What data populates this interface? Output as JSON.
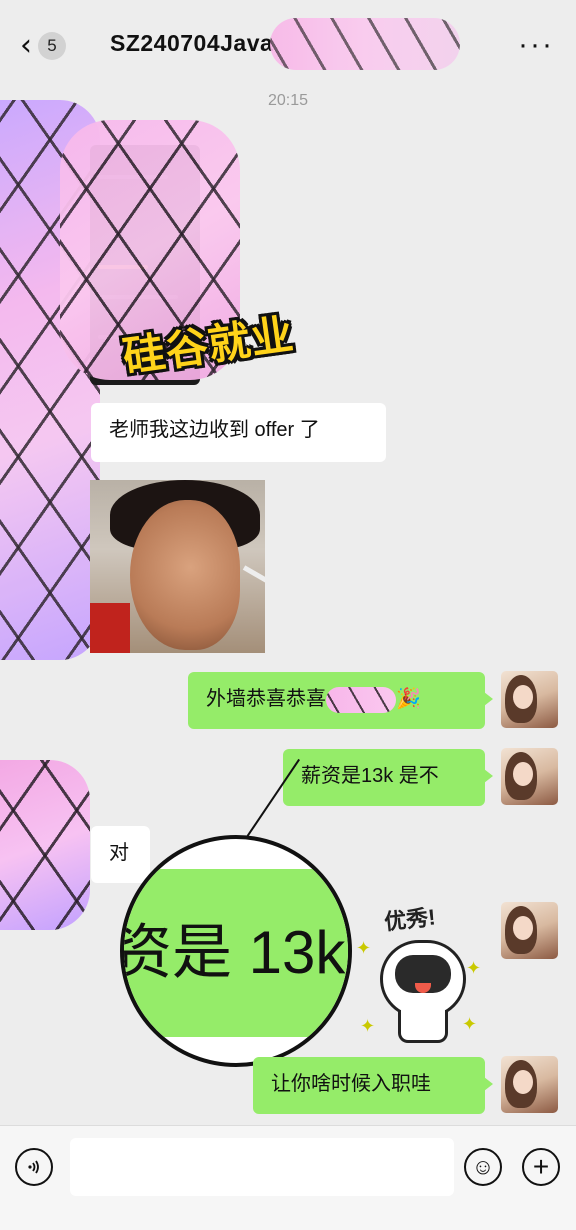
{
  "header": {
    "back_count": "5",
    "title": "SZ240704Java",
    "more_label": "···"
  },
  "chat": {
    "timestamp": "20:15",
    "watermark": "硅谷就业",
    "messages": [
      {
        "side": "left",
        "type": "image",
        "desc_icon": "screenshot-image"
      },
      {
        "side": "left",
        "type": "text",
        "text": "老师我这边收到 offer 了"
      },
      {
        "side": "left",
        "type": "image",
        "desc_icon": "photo-image"
      },
      {
        "side": "right",
        "type": "text",
        "text": "外墙恭喜恭喜",
        "emoji": "🎉"
      },
      {
        "side": "right",
        "type": "text",
        "text": "薪资是13k 是不"
      },
      {
        "side": "left",
        "type": "text",
        "text": "对"
      },
      {
        "side": "right",
        "type": "sticker",
        "text": "优秀!"
      },
      {
        "side": "right",
        "type": "text",
        "text": "让你啥时候入职哇"
      }
    ],
    "magnifier_text": "资是 13k"
  },
  "input_bar": {
    "voice_icon": "voice-icon",
    "emoji_icon": "emoji-icon",
    "plus_icon": "plus-icon",
    "emoji_glyph": "☺",
    "plus_glyph": "+",
    "voice_glyph": "🔊"
  }
}
